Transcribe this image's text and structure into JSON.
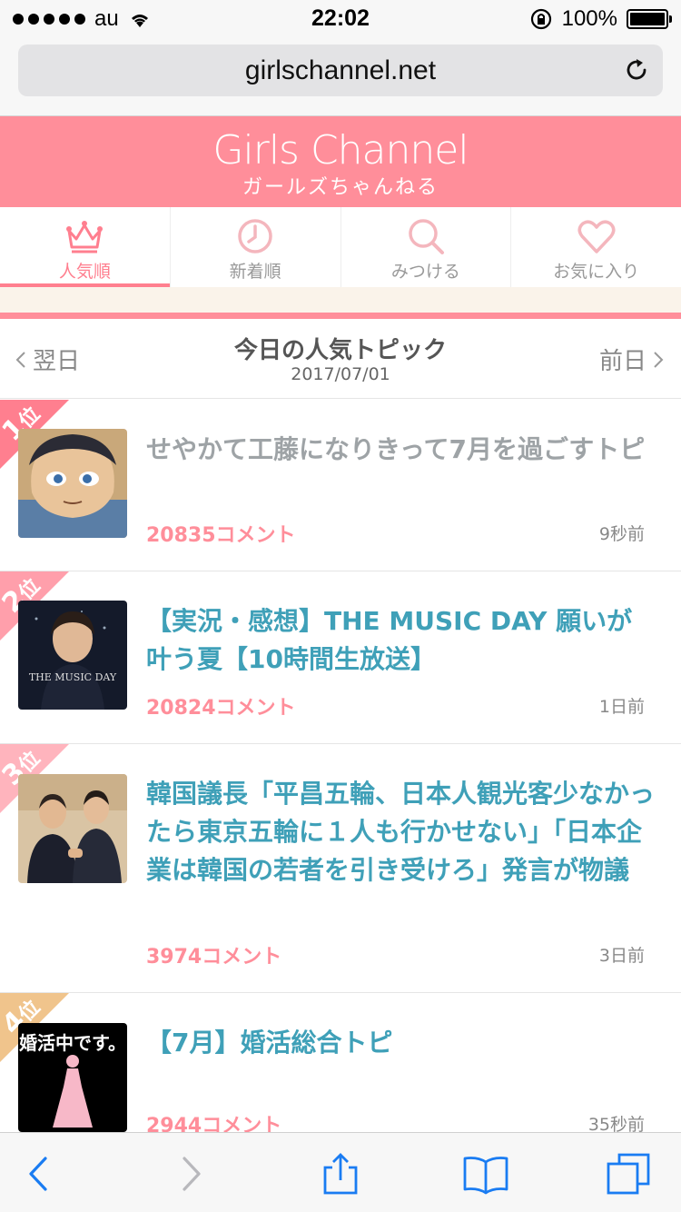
{
  "status": {
    "carrier": "au",
    "time": "22:02",
    "battery": "100%"
  },
  "browser": {
    "url": "girlschannel.net"
  },
  "header": {
    "logo_en": "Girls Channel",
    "logo_jp": "ガールズちゃんねる"
  },
  "tabs": [
    {
      "label": "人気順",
      "icon": "crown-icon"
    },
    {
      "label": "新着順",
      "icon": "clock-icon"
    },
    {
      "label": "みつける",
      "icon": "search-icon"
    },
    {
      "label": "お気に入り",
      "icon": "heart-icon"
    }
  ],
  "day": {
    "prev": "翌日",
    "next": "前日",
    "title": "今日の人気トピック",
    "date": "2017/07/01"
  },
  "topics": [
    {
      "rank": "1",
      "rank_suffix": "位",
      "title": "せやかて工藤になりきって7月を過ごすトピ",
      "comments": "20835コメント",
      "ago": "9秒前",
      "rank_color": "#ff7f8f"
    },
    {
      "rank": "2",
      "rank_suffix": "位",
      "title": "【実況・感想】THE MUSIC DAY 願いが叶う夏【10時間生放送】",
      "comments": "20824コメント",
      "ago": "1日前",
      "rank_color": "#ff9fab",
      "thumb_text": "THE MUSIC DAY"
    },
    {
      "rank": "3",
      "rank_suffix": "位",
      "title": "韓国議長「平昌五輪、日本人観光客少なかったら東京五輪に１人も行かせない」「日本企業は韓国の若者を引き受けろ」発言が物議",
      "comments": "3974コメント",
      "ago": "3日前",
      "rank_color": "#ffb4bd"
    },
    {
      "rank": "4",
      "rank_suffix": "位",
      "title": "【7月】婚活総合トピ",
      "comments": "2944コメント",
      "ago": "35秒前",
      "rank_color": "#f0c48c",
      "thumb_text": "婚活中です。"
    }
  ]
}
